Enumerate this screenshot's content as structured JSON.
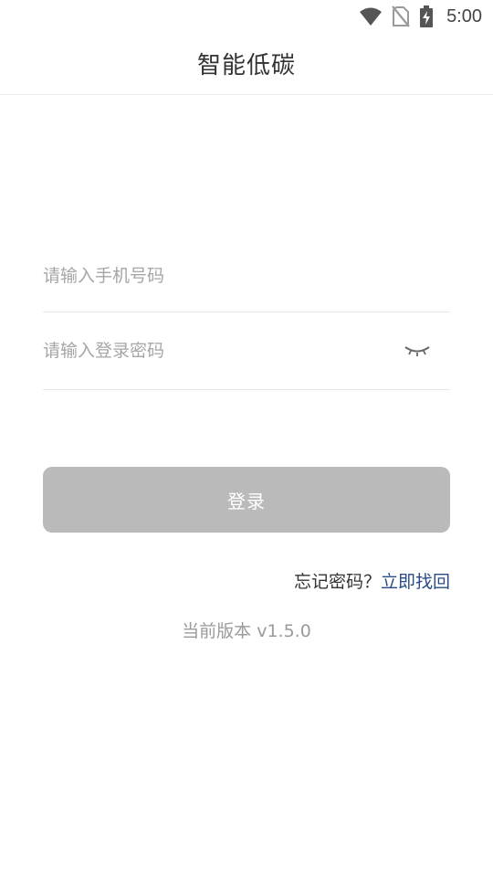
{
  "status_bar": {
    "time": "5:00",
    "icons": [
      "wifi-icon",
      "no-sim-icon",
      "battery-charging-icon"
    ]
  },
  "header": {
    "title": "智能低碳"
  },
  "form": {
    "phone_placeholder": "请输入手机号码",
    "phone_value": "",
    "password_placeholder": "请输入登录密码",
    "password_value": "",
    "password_toggle_icon": "eye-closed-icon",
    "login_label": "登录",
    "login_button_color": "#bababa"
  },
  "forgot": {
    "text": "忘记密码？",
    "link_label": "立即找回",
    "link_color": "#2a4a86"
  },
  "footer": {
    "version_text": "当前版本 v1.5.0"
  }
}
